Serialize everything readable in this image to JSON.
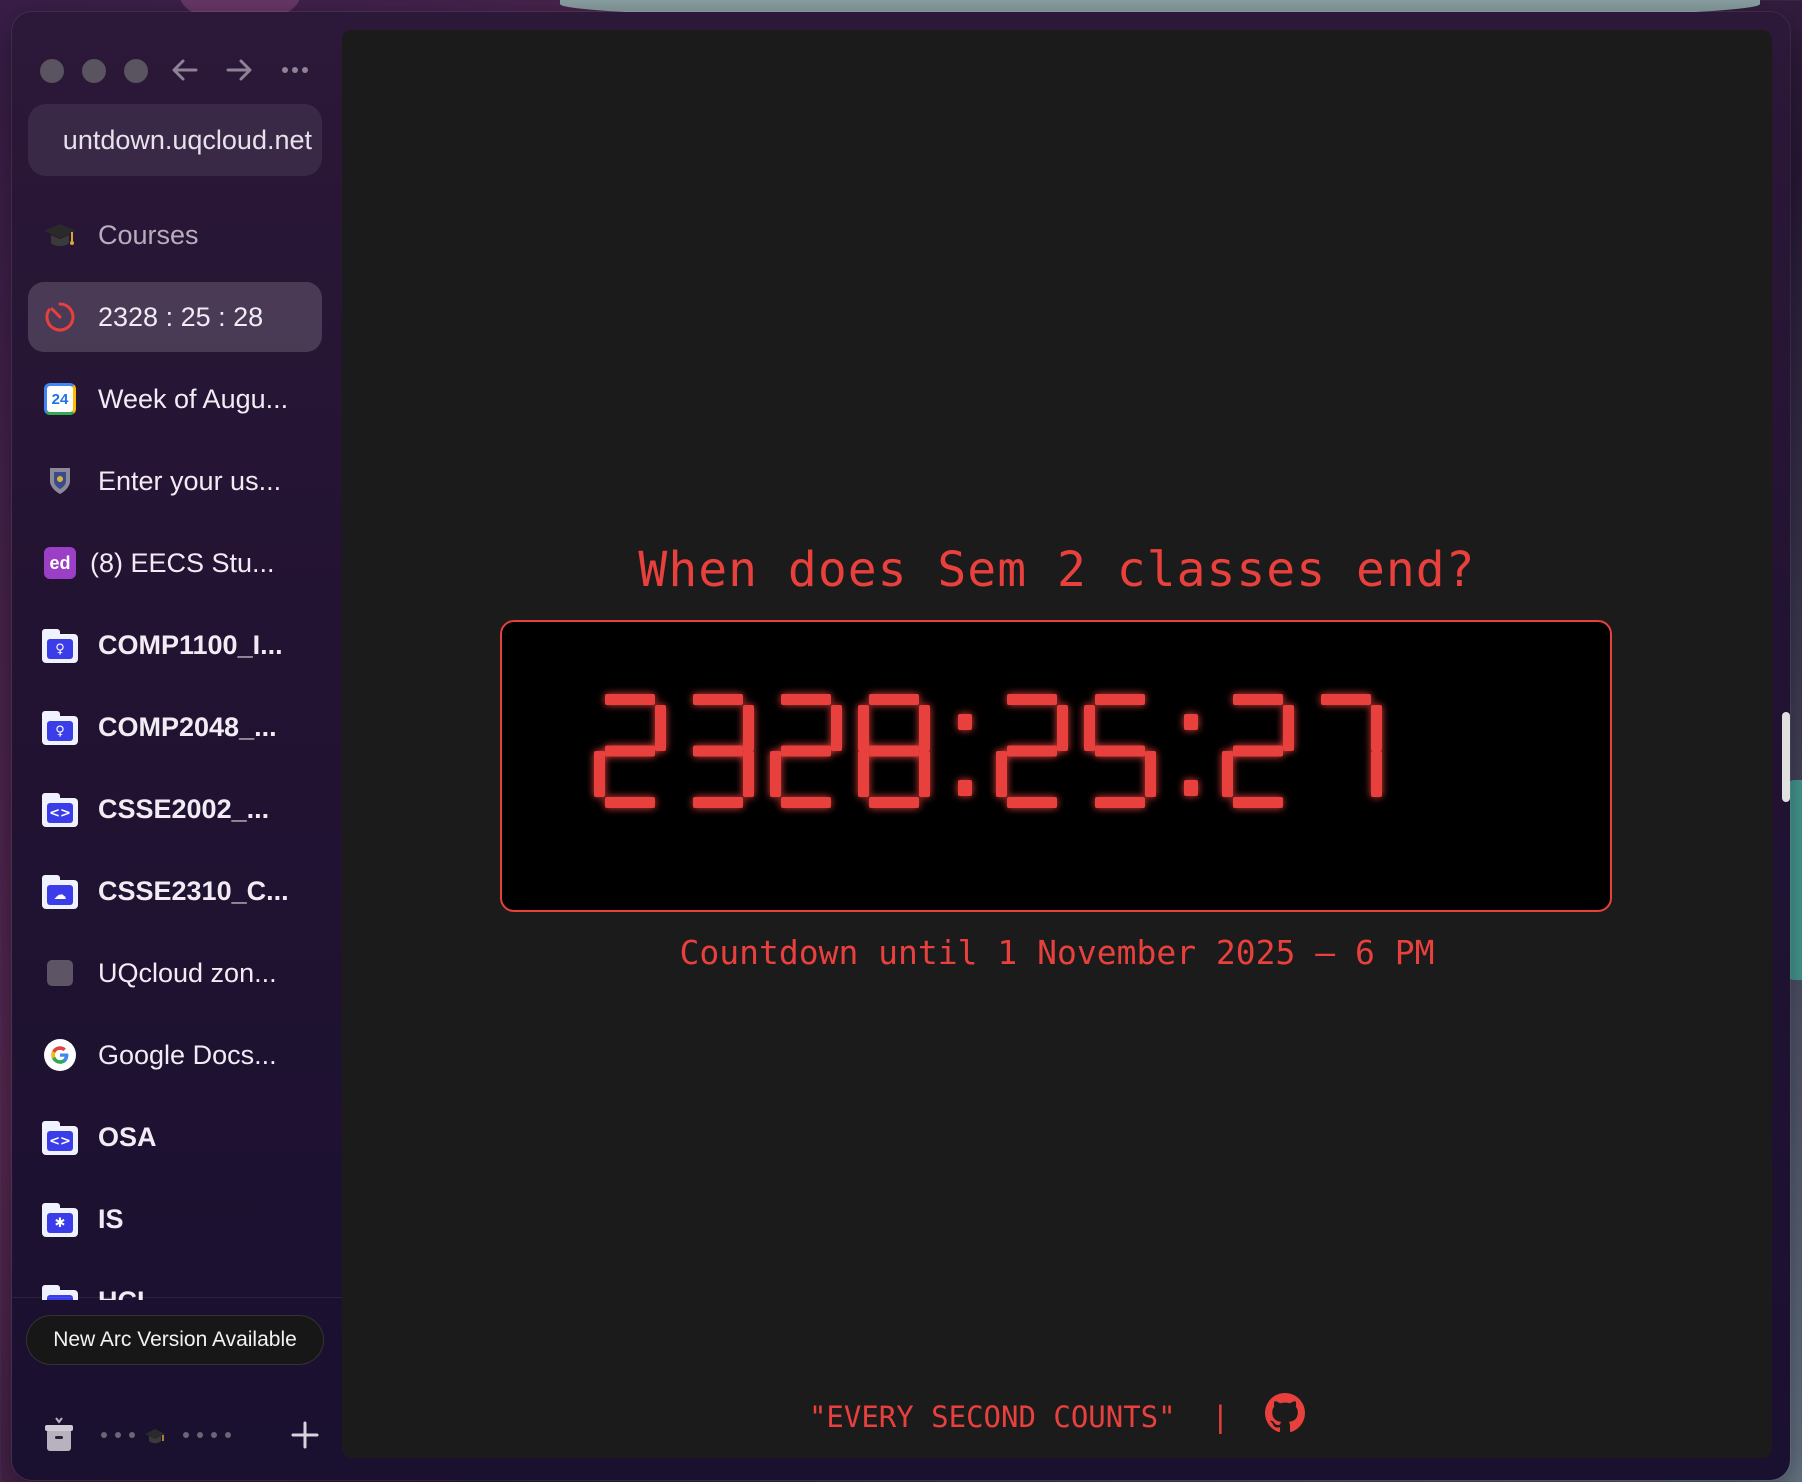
{
  "browser": {
    "url_display": "untdown.uqcloud.net",
    "nav": {
      "back_icon": "arrow-left-icon",
      "forward_icon": "arrow-right-icon",
      "menu_icon": "more-horizontal-icon"
    }
  },
  "sidebar": {
    "tabs": [
      {
        "label": "Courses",
        "icon": "graduation-cap-icon"
      },
      {
        "label": "2328 : 25 : 28",
        "icon": "timer-icon"
      },
      {
        "label": "Week of Augu...",
        "icon": "calendar-icon",
        "icon_text": "24"
      },
      {
        "label": "Enter your us...",
        "icon": "crest-icon"
      },
      {
        "label": "(8) EECS Stu...",
        "icon": "ed-icon",
        "icon_text": "ed"
      },
      {
        "label": "COMP1100_I...",
        "icon": "folder-lightbulb-icon"
      },
      {
        "label": "COMP2048_...",
        "icon": "folder-lightbulb-icon"
      },
      {
        "label": "CSSE2002_...",
        "icon": "folder-code-icon",
        "icon_text": "<>"
      },
      {
        "label": "CSSE2310_C...",
        "icon": "folder-cloud-icon"
      },
      {
        "label": "UQcloud zon...",
        "icon": "square-icon"
      },
      {
        "label": "Google Docs...",
        "icon": "google-icon"
      },
      {
        "label": "OSA",
        "icon": "folder-code-icon",
        "icon_text": "<>"
      },
      {
        "label": "IS",
        "icon": "folder-asterisk-icon",
        "icon_text": "✱"
      },
      {
        "label": "HCI",
        "icon": "folder-icon"
      }
    ],
    "update_notice": "New Arc Version Available"
  },
  "page": {
    "heading": "When does Sem 2 classes end?",
    "countdown": {
      "hours": "2328",
      "minutes": "25",
      "seconds": "27",
      "color": "#e8403d"
    },
    "subtitle": "Countdown until 1 November 2025 – 6 PM",
    "footer_quote": "\"EVERY SECOND COUNTS\"",
    "footer_separator": "|",
    "footer_icon": "github-icon"
  }
}
